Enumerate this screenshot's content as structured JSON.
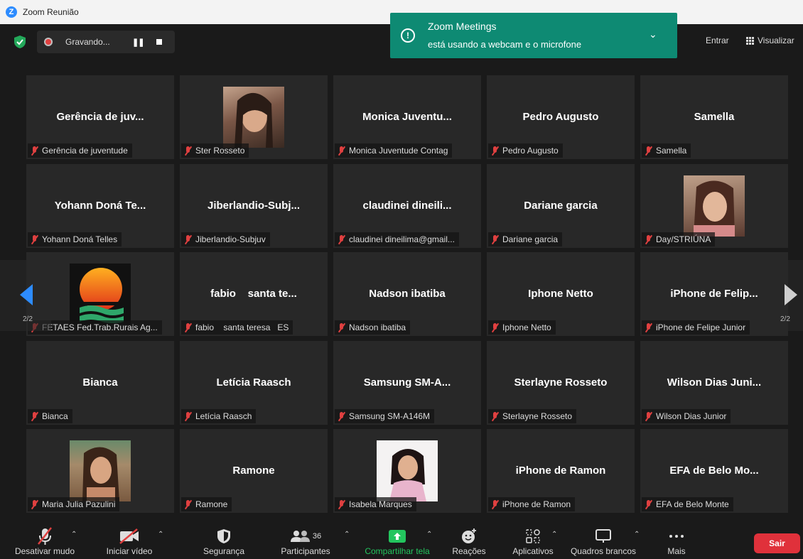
{
  "window": {
    "title": "Zoom Reunião"
  },
  "recording": {
    "label": "Gravando..."
  },
  "topbar": {
    "entrar": "Entrar",
    "visualizar": "Visualizar"
  },
  "notification": {
    "title": "Zoom Meetings",
    "message": "está usando a webcam e o microfone"
  },
  "pagination": {
    "left": "2/2",
    "right": "2/2"
  },
  "tiles": [
    {
      "big": "Gerência de juv...",
      "label": "Gerência de juventude"
    },
    {
      "big": "",
      "label": "Ster Rosseto"
    },
    {
      "big": "Monica Juventu...",
      "label": "Monica Juventude Contag"
    },
    {
      "big": "Pedro Augusto",
      "label": "Pedro Augusto"
    },
    {
      "big": "Samella",
      "label": "Samella"
    },
    {
      "big": "Yohann Doná Te...",
      "label": "Yohann Doná Telles"
    },
    {
      "big": "Jiberlandio-Subj...",
      "label": "Jiberlandio-Subjuv"
    },
    {
      "big": "claudinei dineili...",
      "label": "claudinei dineilima@gmail..."
    },
    {
      "big": "Dariane garcia",
      "label": "Dariane garcia"
    },
    {
      "big": "",
      "label": "Day/STRIÚNA"
    },
    {
      "big": "",
      "label": "FETAES Fed.Trab.Rurais Ag..."
    },
    {
      "big": "fabio    santa te...",
      "label": "fabio    santa teresa   ES"
    },
    {
      "big": "Nadson ibatiba",
      "label": "Nadson ibatiba"
    },
    {
      "big": "Iphone Netto",
      "label": "Iphone Netto"
    },
    {
      "big": "iPhone de Felip...",
      "label": "iPhone de Felipe Junior"
    },
    {
      "big": "Bianca",
      "label": "Bianca"
    },
    {
      "big": "Letícia Raasch",
      "label": "Letícia Raasch"
    },
    {
      "big": "Samsung SM-A...",
      "label": "Samsung SM-A146M"
    },
    {
      "big": "Sterlayne Rosseto",
      "label": "Sterlayne Rosseto"
    },
    {
      "big": "Wilson Dias Juni...",
      "label": "Wilson Dias Junior"
    },
    {
      "big": "",
      "label": "Maria Julia Pazulini"
    },
    {
      "big": "Ramone",
      "label": "Ramone"
    },
    {
      "big": "",
      "label": "Isabela Marques"
    },
    {
      "big": "iPhone de Ramon",
      "label": "iPhone de Ramon"
    },
    {
      "big": "EFA de Belo Mo...",
      "label": "EFA de Belo Monte"
    }
  ],
  "toolbar": {
    "mute": "Desativar mudo",
    "video": "Iniciar vídeo",
    "security": "Segurança",
    "participants": "Participantes",
    "participants_count": "36",
    "share": "Compartilhar tela",
    "reactions": "Reações",
    "apps": "Aplicativos",
    "whiteboards": "Quadros brancos",
    "more": "Mais",
    "leave": "Sair"
  },
  "colors": {
    "accent_green": "#0e8a73",
    "share_green": "#23c55e",
    "leave_red": "#e0313b",
    "mic_off": "#e04040"
  }
}
